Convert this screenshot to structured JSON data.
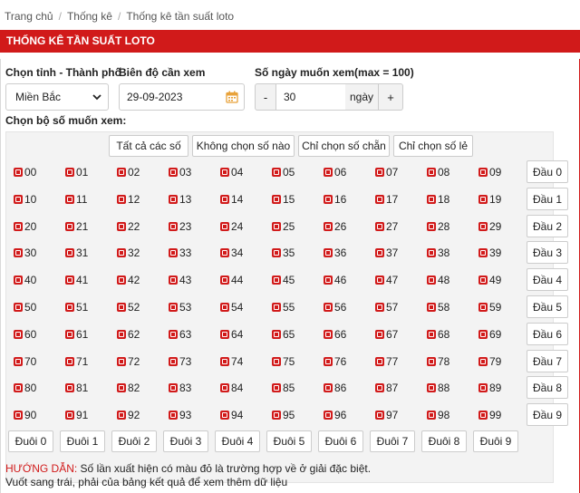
{
  "breadcrumb": [
    "Trang chủ",
    "Thống kê",
    "Thống kê tần suất loto"
  ],
  "breadcrumb_sep": "/",
  "title": "THỐNG KÊ TẦN SUẤT LOTO",
  "filters": {
    "province_label": "Chọn tỉnh - Thành phố",
    "province_value": "Miền Bắc",
    "date_label": "Biên độ cần xem",
    "date_value": "29-09-2023",
    "days_label": "Số ngày muốn xem(max = 100)",
    "days_value": "30",
    "days_unit": "ngày",
    "minus": "-",
    "plus": "+"
  },
  "select_set_label": "Chọn bộ số muốn xem:",
  "quick_buttons": [
    "Tất cả các số",
    "Không chọn số nào",
    "Chỉ chọn số chẵn",
    "Chỉ chọn số lẻ"
  ],
  "numbers": [
    [
      "00",
      "01",
      "02",
      "03",
      "04",
      "05",
      "06",
      "07",
      "08",
      "09"
    ],
    [
      "10",
      "11",
      "12",
      "13",
      "14",
      "15",
      "16",
      "17",
      "18",
      "19"
    ],
    [
      "20",
      "21",
      "22",
      "23",
      "24",
      "25",
      "26",
      "27",
      "28",
      "29"
    ],
    [
      "30",
      "31",
      "32",
      "33",
      "34",
      "35",
      "36",
      "37",
      "38",
      "39"
    ],
    [
      "40",
      "41",
      "42",
      "43",
      "44",
      "45",
      "46",
      "47",
      "48",
      "49"
    ],
    [
      "50",
      "51",
      "52",
      "53",
      "54",
      "55",
      "56",
      "57",
      "58",
      "59"
    ],
    [
      "60",
      "61",
      "62",
      "63",
      "64",
      "65",
      "66",
      "67",
      "68",
      "69"
    ],
    [
      "70",
      "71",
      "72",
      "73",
      "74",
      "75",
      "76",
      "77",
      "78",
      "79"
    ],
    [
      "80",
      "81",
      "82",
      "83",
      "84",
      "85",
      "86",
      "87",
      "88",
      "89"
    ],
    [
      "90",
      "91",
      "92",
      "93",
      "94",
      "95",
      "96",
      "97",
      "98",
      "99"
    ]
  ],
  "head_buttons": [
    "Đầu 0",
    "Đầu 1",
    "Đầu 2",
    "Đầu 3",
    "Đầu 4",
    "Đầu 5",
    "Đầu 6",
    "Đầu 7",
    "Đầu 8",
    "Đầu 9"
  ],
  "tail_buttons": [
    "Đuôi 0",
    "Đuôi 1",
    "Đuôi 2",
    "Đuôi 3",
    "Đuôi 4",
    "Đuôi 5",
    "Đuôi 6",
    "Đuôi 7",
    "Đuôi 8",
    "Đuôi 9"
  ],
  "guide": {
    "prefix": "HƯỚNG DẪN:",
    "line1": " Số lần xuất hiện có màu đỏ là trường hợp về ở giải đặc biệt.",
    "line2": "Vuốt sang trái, phải của bảng kết quả để xem thêm dữ liệu"
  },
  "colors": {
    "accent": "#d11a1a",
    "checkbox": "#d11a1a",
    "grid_bg": "#f3f3f3"
  },
  "all_checked": true
}
